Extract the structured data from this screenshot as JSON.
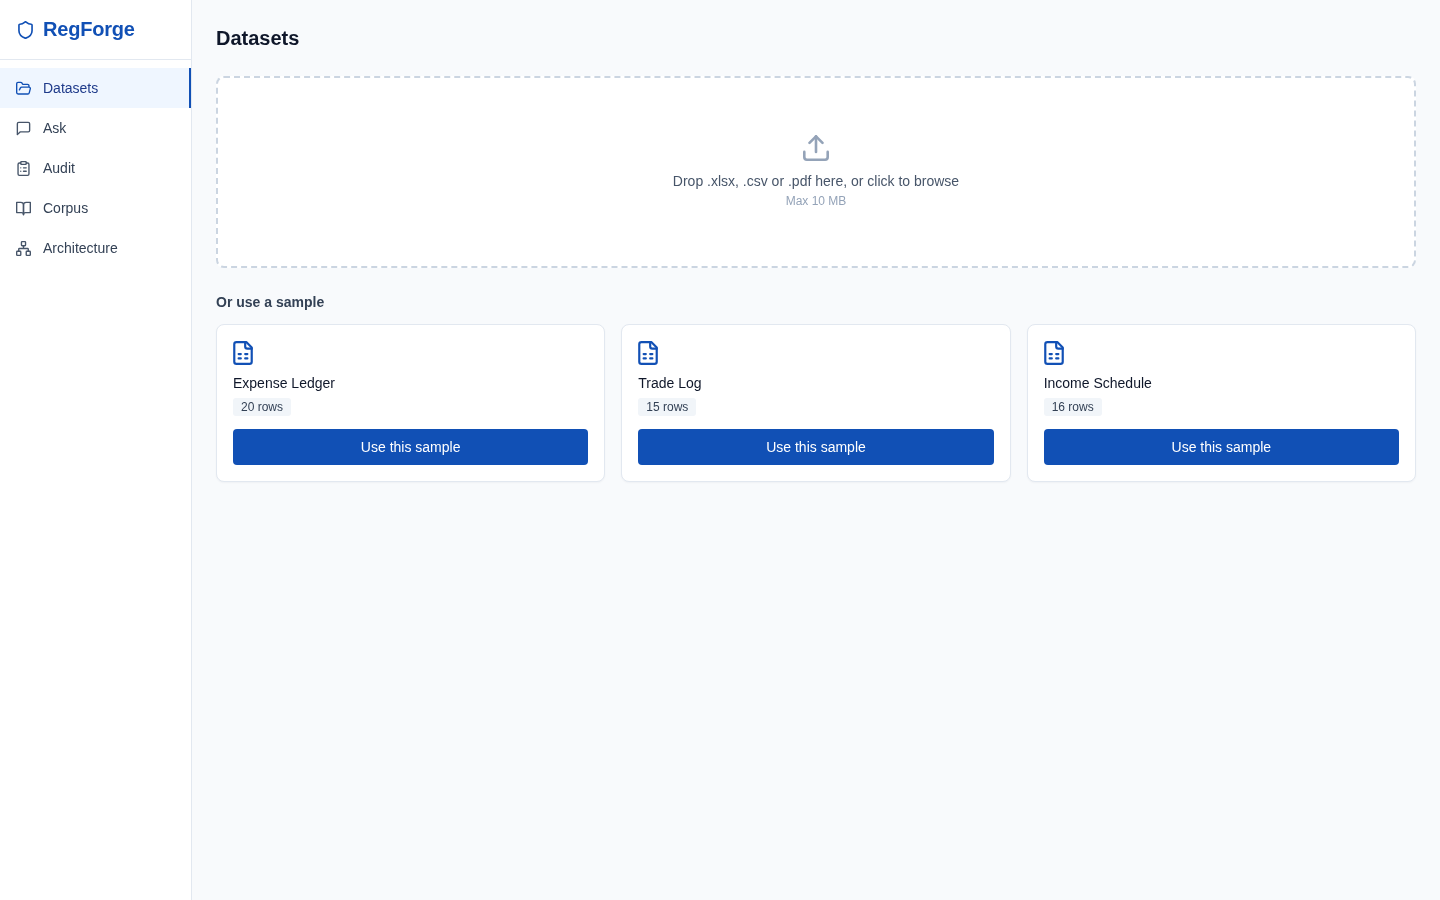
{
  "sidebar": {
    "brand": "RegForge",
    "items": [
      {
        "label": "Datasets",
        "selected": true
      },
      {
        "label": "Ask",
        "selected": false
      },
      {
        "label": "Audit",
        "selected": false
      },
      {
        "label": "Corpus",
        "selected": false
      },
      {
        "label": "Architecture",
        "selected": false
      }
    ]
  },
  "page": {
    "title": "Datasets"
  },
  "dropzone": {
    "prompt": "Drop .xlsx, .csv or .pdf here, or click to browse",
    "limit": "Max 10 MB"
  },
  "samples": {
    "heading": "Or use a sample",
    "cards": [
      {
        "name": "Expense Ledger",
        "rows": "20 rows",
        "button": "Use this sample"
      },
      {
        "name": "Trade Log",
        "rows": "15 rows",
        "button": "Use this sample"
      },
      {
        "name": "Income Schedule",
        "rows": "16 rows",
        "button": "Use this sample"
      }
    ]
  }
}
